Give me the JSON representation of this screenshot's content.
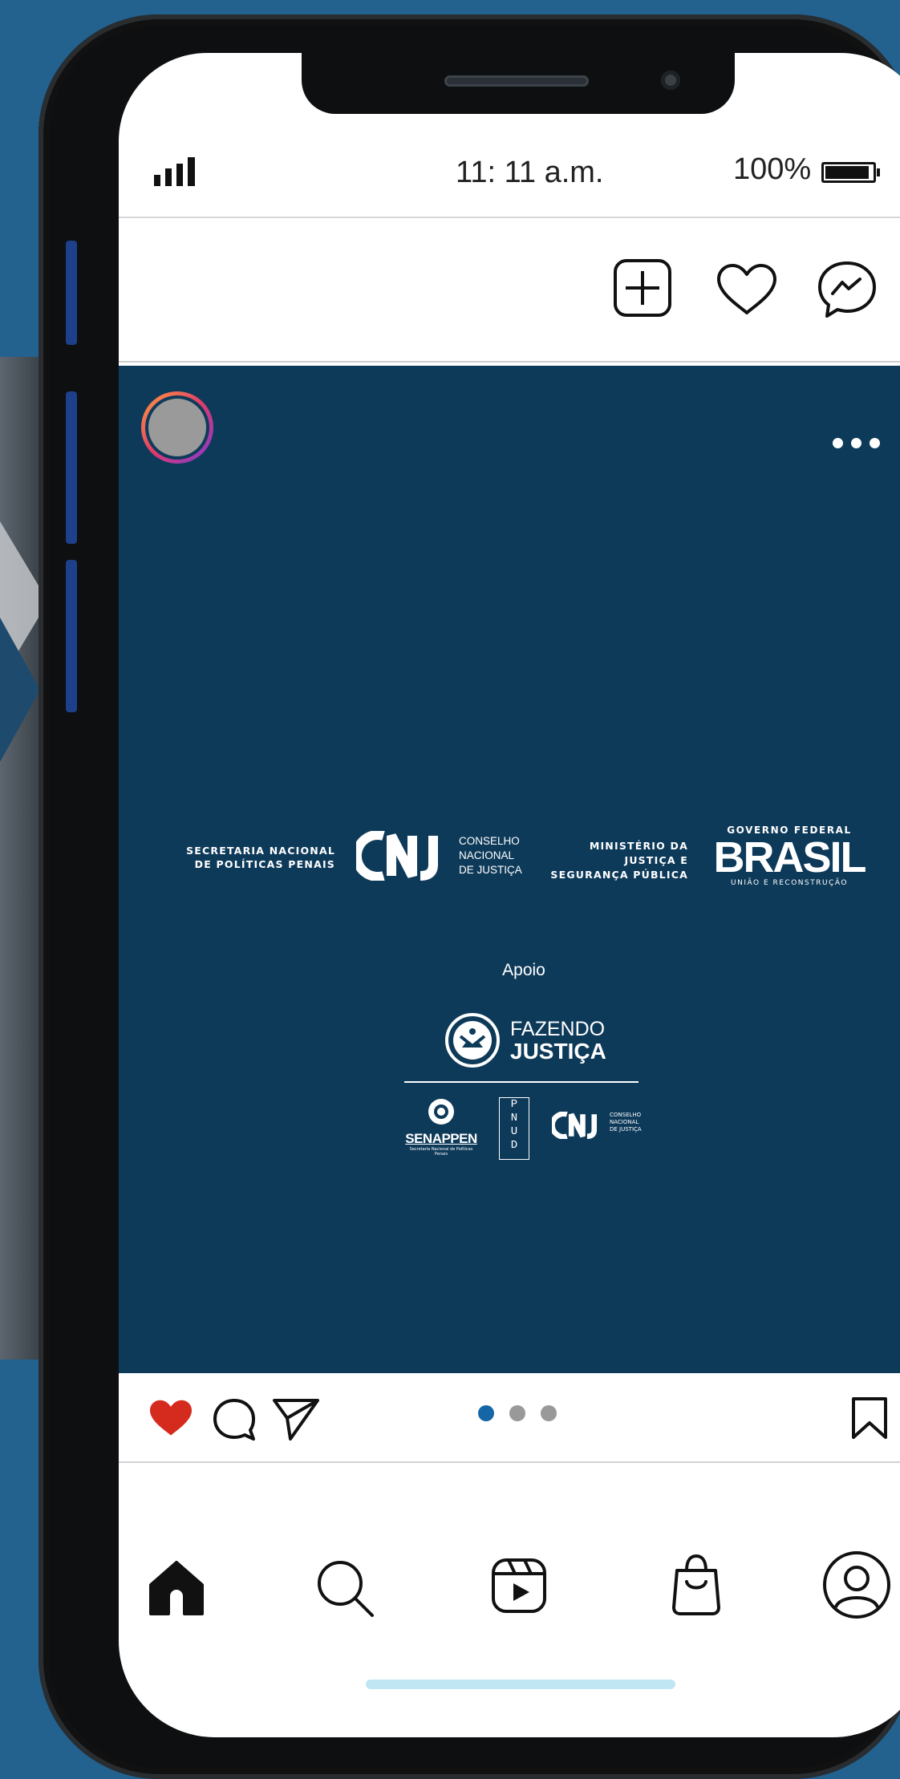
{
  "status_bar": {
    "time": "11: 11 a.m.",
    "battery": "100%",
    "battery_level": 1.0
  },
  "post": {
    "logos": {
      "snpp": [
        "SECRETARIA NACIONAL",
        "DE POLÍTICAS PENAIS"
      ],
      "cnj": "CNJ",
      "cnj_name": [
        "CONSELHO",
        "NACIONAL",
        "DE JUSTIÇA"
      ],
      "mj": [
        "MINISTÉRIO DA",
        "JUSTIÇA E",
        "SEGURANÇA PÚBLICA"
      ],
      "gov_top": "GOVERNO FEDERAL",
      "gov_brasil": "BRASIL",
      "gov_sub": "UNIÃO E RECONSTRUÇÃO"
    },
    "apoio": "Apoio",
    "fazendo_justica": {
      "line1": "FAZENDO",
      "line2": "JUSTIÇA"
    },
    "partners": {
      "senappen": "SENAPPEN",
      "senappen_sub": "Secretaria Nacional de Políticas Penais",
      "pnud": [
        "P",
        "N",
        "U",
        "D"
      ],
      "cnj_small": "CNJ",
      "cnj_small_name": [
        "CONSELHO",
        "NACIONAL",
        "DE JUSTIÇA"
      ]
    }
  },
  "carousel": {
    "count": 3,
    "active": 1
  },
  "colors": {
    "post_bg": "#0e3a5a",
    "like": "#d52b1e",
    "dot_active": "#1466a6"
  }
}
